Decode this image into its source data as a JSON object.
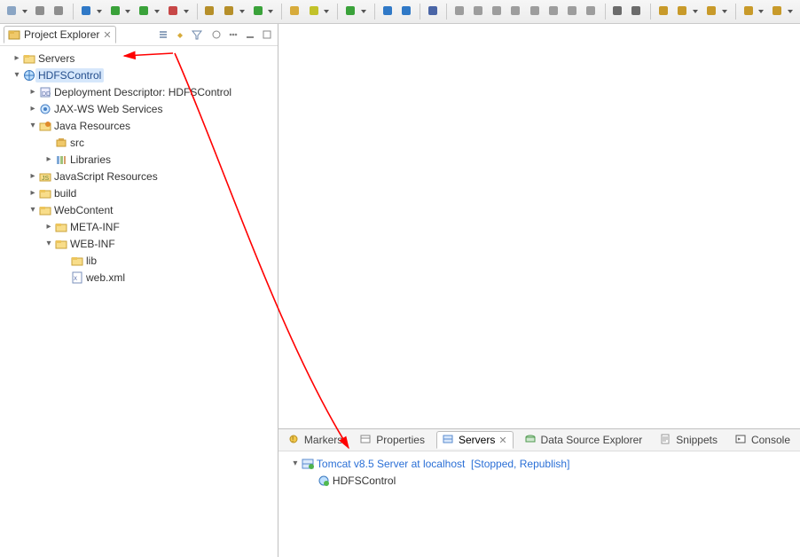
{
  "toolbar": {
    "groups": [
      [
        {
          "name": "new-button",
          "color": "#8aa5c4",
          "drop": true
        },
        {
          "name": "save-icon",
          "color": "#8e8e8e",
          "drop": false
        },
        {
          "name": "save-all-icon",
          "color": "#8e8e8e",
          "drop": false
        }
      ],
      [
        {
          "name": "debug-bug-icon",
          "color": "#3079c7",
          "drop": true
        },
        {
          "name": "run-play-icon",
          "color": "#3aa23a",
          "drop": true
        },
        {
          "name": "run-server-play-icon",
          "color": "#3aa23a",
          "drop": true
        },
        {
          "name": "run-ext-tool-icon",
          "color": "#c74747",
          "drop": true
        }
      ],
      [
        {
          "name": "build-project-icon",
          "color": "#b68f2a",
          "drop": false
        },
        {
          "name": "new-package-icon",
          "color": "#b68f2a",
          "drop": true
        },
        {
          "name": "new-class-icon",
          "color": "#3aa23a",
          "drop": true
        }
      ],
      [
        {
          "name": "open-folder-icon",
          "color": "#d7ab3b",
          "drop": false
        },
        {
          "name": "search-icon",
          "color": "#c2c22a",
          "drop": true
        }
      ],
      [
        {
          "name": "open-browser-icon",
          "color": "#3aa23a",
          "drop": true
        }
      ],
      [
        {
          "name": "toggle-breadcrumb-icon",
          "color": "#3079c7",
          "drop": false
        },
        {
          "name": "toggle-block-sel-icon",
          "color": "#3079c7",
          "drop": false
        }
      ],
      [
        {
          "name": "skip-breakpoints-icon",
          "color": "#4a65a6",
          "drop": false
        }
      ],
      [
        {
          "name": "resume-icon",
          "color": "#9d9d9d",
          "drop": false
        },
        {
          "name": "suspend-icon",
          "color": "#9d9d9d",
          "drop": false
        },
        {
          "name": "terminate-icon",
          "color": "#9d9d9d",
          "drop": false
        },
        {
          "name": "disconnect-icon",
          "color": "#9d9d9d",
          "drop": false
        },
        {
          "name": "step-into-icon",
          "color": "#9d9d9d",
          "drop": false
        },
        {
          "name": "step-over-icon",
          "color": "#9d9d9d",
          "drop": false
        },
        {
          "name": "step-return-icon",
          "color": "#9d9d9d",
          "drop": false
        },
        {
          "name": "drop-to-frame-icon",
          "color": "#9d9d9d",
          "drop": false
        }
      ],
      [
        {
          "name": "format-icon",
          "color": "#6b6b6b",
          "drop": false
        },
        {
          "name": "organize-icon",
          "color": "#6b6b6b",
          "drop": false
        }
      ],
      [
        {
          "name": "pin-icon",
          "color": "#c89a2a",
          "drop": false
        },
        {
          "name": "next-annotation-icon",
          "color": "#c89a2a",
          "drop": true
        },
        {
          "name": "prev-annotation-icon",
          "color": "#c89a2a",
          "drop": true
        }
      ],
      [
        {
          "name": "back-history-icon",
          "color": "#c89a2a",
          "drop": true
        },
        {
          "name": "forward-history-icon",
          "color": "#c89a2a",
          "drop": true
        }
      ]
    ]
  },
  "projectExplorer": {
    "title": "Project Explorer",
    "toolbar_icons": [
      "collapse-all-icon",
      "link-editor-icon",
      "filter-icon",
      "focus-task-icon",
      "view-menu-icon",
      "minimize-icon",
      "maximize-icon"
    ]
  },
  "tree": [
    {
      "depth": 1,
      "exp": "closed",
      "icon": "folder",
      "label": "Servers",
      "sel": false,
      "name": "tree-servers"
    },
    {
      "depth": 1,
      "exp": "open",
      "icon": "webproj",
      "label": "HDFSControl",
      "sel": true,
      "name": "tree-hdfscontrol"
    },
    {
      "depth": 2,
      "exp": "closed",
      "icon": "dd",
      "label": "Deployment Descriptor: HDFSControl",
      "sel": false,
      "name": "tree-deployment-descriptor"
    },
    {
      "depth": 2,
      "exp": "closed",
      "icon": "jaxws",
      "label": "JAX-WS Web Services",
      "sel": false,
      "name": "tree-jaxws"
    },
    {
      "depth": 2,
      "exp": "open",
      "icon": "javares",
      "label": "Java Resources",
      "sel": false,
      "name": "tree-java-resources"
    },
    {
      "depth": 3,
      "exp": "none",
      "icon": "pkgroot",
      "label": "src",
      "sel": false,
      "name": "tree-src"
    },
    {
      "depth": 3,
      "exp": "closed",
      "icon": "libs",
      "label": "Libraries",
      "sel": false,
      "name": "tree-libraries"
    },
    {
      "depth": 2,
      "exp": "closed",
      "icon": "jsres",
      "label": "JavaScript Resources",
      "sel": false,
      "name": "tree-js-resources"
    },
    {
      "depth": 2,
      "exp": "closed",
      "icon": "folder",
      "label": "build",
      "sel": false,
      "name": "tree-build"
    },
    {
      "depth": 2,
      "exp": "open",
      "icon": "folder",
      "label": "WebContent",
      "sel": false,
      "name": "tree-webcontent"
    },
    {
      "depth": 3,
      "exp": "closed",
      "icon": "folder",
      "label": "META-INF",
      "sel": false,
      "name": "tree-meta-inf"
    },
    {
      "depth": 3,
      "exp": "open",
      "icon": "folder",
      "label": "WEB-INF",
      "sel": false,
      "name": "tree-web-inf"
    },
    {
      "depth": 4,
      "exp": "none",
      "icon": "folder",
      "label": "lib",
      "sel": false,
      "name": "tree-lib"
    },
    {
      "depth": 4,
      "exp": "none",
      "icon": "xml",
      "label": "web.xml",
      "sel": false,
      "name": "tree-web-xml"
    }
  ],
  "bottomTabs": [
    {
      "icon": "markers",
      "label": "Markers",
      "active": false,
      "name": "tab-markers"
    },
    {
      "icon": "properties",
      "label": "Properties",
      "active": false,
      "name": "tab-properties"
    },
    {
      "icon": "servers",
      "label": "Servers",
      "active": true,
      "name": "tab-servers"
    },
    {
      "icon": "dse",
      "label": "Data Source Explorer",
      "active": false,
      "name": "tab-data-source-explorer"
    },
    {
      "icon": "snippets",
      "label": "Snippets",
      "active": false,
      "name": "tab-snippets"
    },
    {
      "icon": "console",
      "label": "Console",
      "active": false,
      "name": "tab-console"
    }
  ],
  "serversView": {
    "server_label": "Tomcat v8.5 Server at localhost",
    "server_status": "[Stopped, Republish]",
    "module_label": "HDFSControl"
  },
  "annotation": {
    "arrow_color": "#ff0000"
  }
}
